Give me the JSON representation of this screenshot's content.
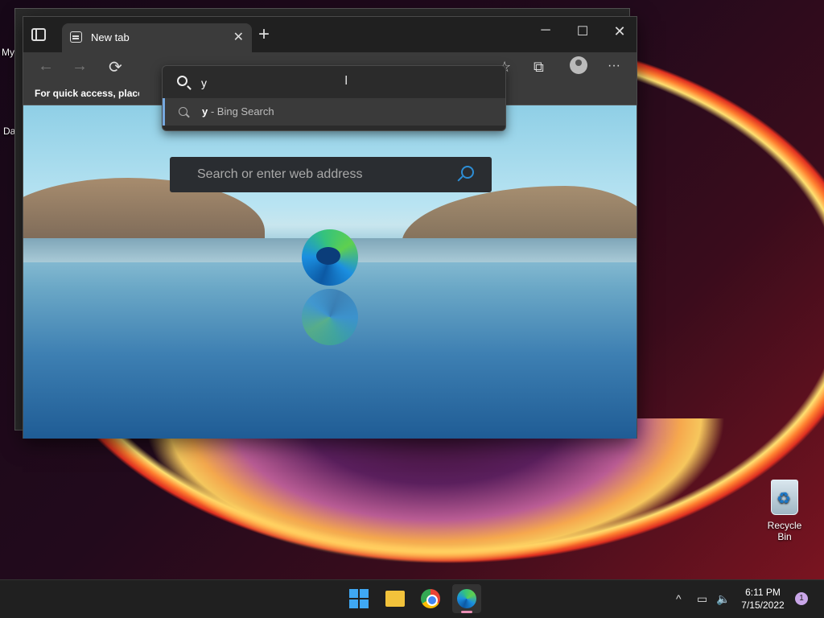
{
  "desktop": {
    "icon_partial_1": "My",
    "icon_partial_2": "Da",
    "recycle_bin": "Recycle Bin"
  },
  "browser": {
    "tab": {
      "title": "New tab",
      "close": "✕"
    },
    "new_tab": "+",
    "window": {
      "minimize": "─",
      "maximize": "☐",
      "close": "✕"
    },
    "nav": {
      "back": "←",
      "forward": "→",
      "refresh": "⟳"
    },
    "bookmarks_hint": "For quick access, place y",
    "omnibox": {
      "value": "y",
      "suggestion_query": "y",
      "suggestion_rest": " - Bing Search"
    },
    "toolbar_icons": {
      "favorites": "☆",
      "collections": "⧉",
      "more": "···"
    },
    "page_search": {
      "placeholder": "Search or enter web address"
    }
  },
  "taskbar": {
    "tray_chevron": "^",
    "clock_time": "6:11 PM",
    "clock_date": "7/15/2022",
    "notification_count": "1"
  },
  "colors": {
    "accent": "#76a9e0",
    "taskbar": "#202020",
    "browser_frame": "#3b3b3b"
  }
}
